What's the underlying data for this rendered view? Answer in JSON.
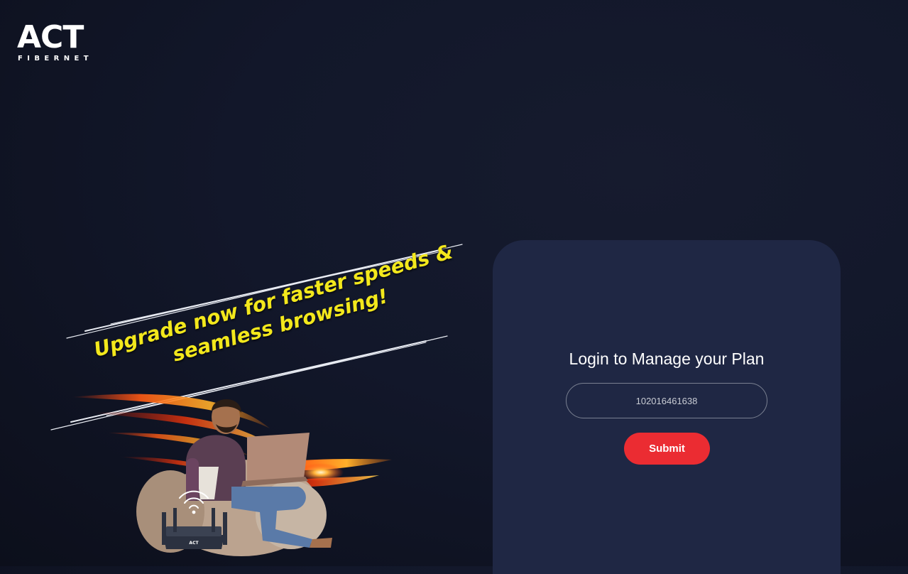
{
  "brand": {
    "logo_word": "ACT",
    "logo_sub": "FIBERNET"
  },
  "promo": {
    "tagline": "Upgrade now for faster speeds & seamless browsing!",
    "router_label": "ACT"
  },
  "login": {
    "title": "Login to Manage your Plan",
    "account_value": "102016461638",
    "submit_label": "Submit"
  },
  "colors": {
    "accent": "#eb2c32",
    "tagline": "#f3e81c",
    "card_bg": "#1f2744",
    "page_bg": "#12172a"
  }
}
